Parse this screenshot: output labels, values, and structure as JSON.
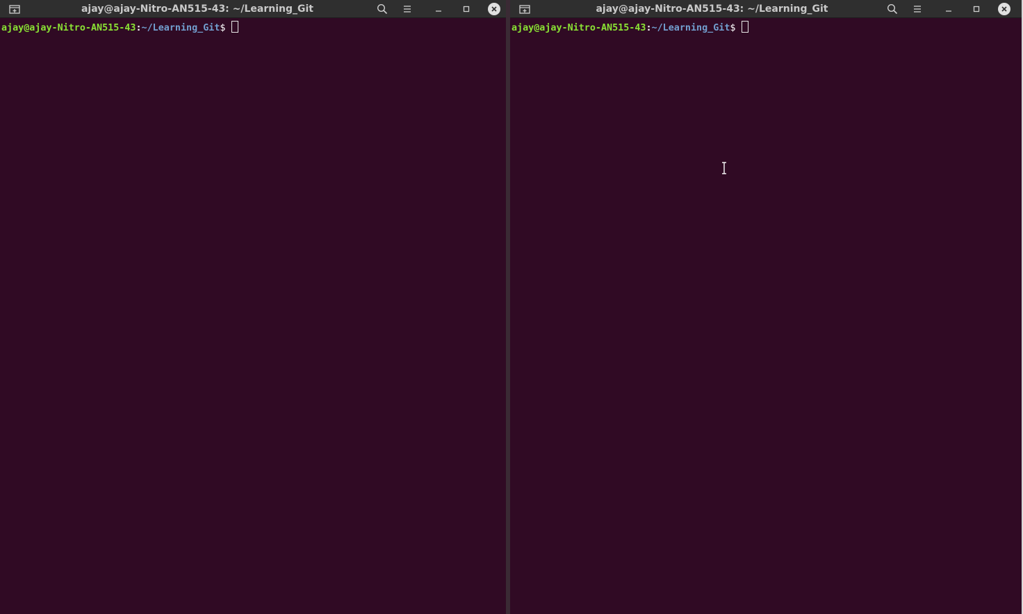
{
  "colors": {
    "terminal_bg": "#300a24",
    "titlebar_bg": "#2f2f2f",
    "prompt_user": "#8ae234",
    "prompt_path": "#729fcf"
  },
  "windows": [
    {
      "title": "ajay@ajay-Nitro-AN515-43: ~/Learning_Git",
      "prompt": {
        "user_host": "ajay@ajay-Nitro-AN515-43",
        "colon": ":",
        "path": "~/Learning_Git",
        "symbol": "$"
      },
      "icons": [
        "new-tab-icon",
        "search-icon",
        "hamburger-menu-icon",
        "minimize-icon",
        "maximize-icon",
        "close-icon"
      ]
    },
    {
      "title": "ajay@ajay-Nitro-AN515-43: ~/Learning_Git",
      "prompt": {
        "user_host": "ajay@ajay-Nitro-AN515-43",
        "colon": ":",
        "path": "~/Learning_Git",
        "symbol": "$"
      },
      "icons": [
        "new-tab-icon",
        "search-icon",
        "hamburger-menu-icon",
        "minimize-icon",
        "maximize-icon",
        "close-icon"
      ]
    }
  ]
}
